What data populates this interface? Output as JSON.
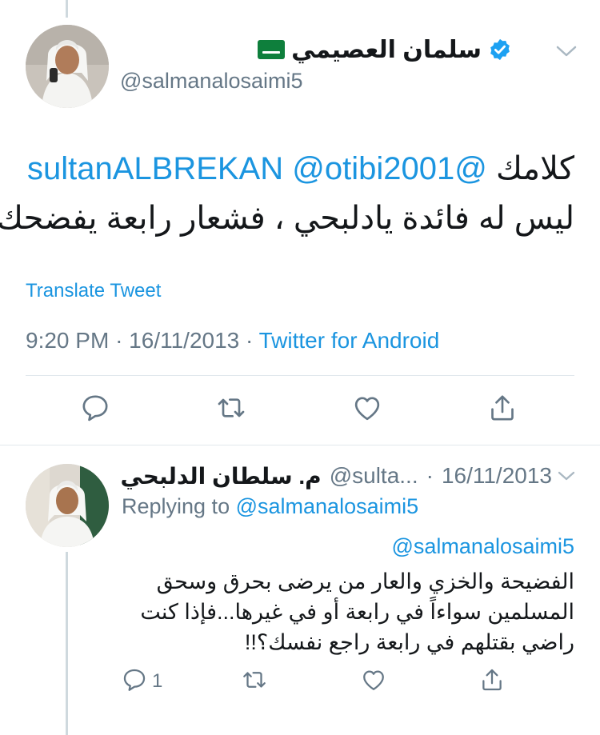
{
  "main_tweet": {
    "display_name": "سلمان العصيمي",
    "handle": "@salmanalosaimi5",
    "mention_1": "@otibi2001",
    "mention_2": "@sultanALBREKAN",
    "text_line_1_suffix": "كلامك",
    "text_line_2": "ليس له فائدة يادلبحي ، فشعار رابعة يفضحك",
    "translate_label": "Translate Tweet",
    "time": "9:20 PM",
    "date": "16/11/2013",
    "separator": "·",
    "source": "Twitter for Android",
    "verified": true
  },
  "reply_tweet": {
    "display_name": "م. سلطان الدلبحي",
    "handle": "@sulta...",
    "separator": "·",
    "date": "16/11/2013",
    "replying_to_label": "Replying to",
    "replying_to_handle": "@salmanalosaimi5",
    "mention": "@salmanalosaimi5",
    "text_lines": [
      "الفضيحة والخزي والعار من يرضى بحرق وسحق",
      "المسلمين سواءاً في رابعة أو في غيرها...فإذا كنت",
      "راضي بقتلهم في رابعة راجع نفسك؟!!"
    ],
    "reply_count": "1"
  },
  "icons": {
    "reply": "reply-icon",
    "retweet": "retweet-icon",
    "like": "heart-icon",
    "share": "share-icon",
    "chevron": "chevron-down-icon",
    "verified": "verified-badge-icon",
    "flag": "saudi-flag-icon"
  },
  "colors": {
    "link": "#1b95e0",
    "secondary_text": "#657786",
    "icon": "#657786",
    "divider": "#e1e8ed"
  }
}
